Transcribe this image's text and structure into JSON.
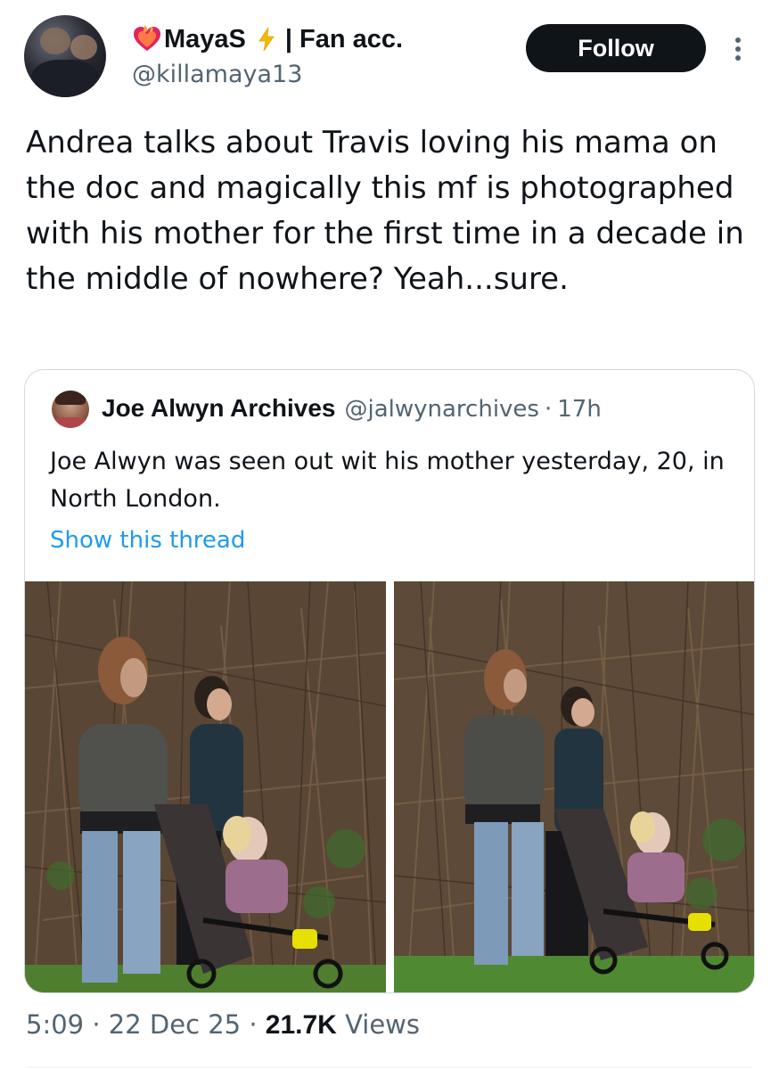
{
  "author": {
    "display_name": "MayaS",
    "name_suffix": "| Fan acc.",
    "handle": "@killamaya13",
    "heart_icon": "flaming-heart-icon",
    "bolt_icon": "lightning-icon"
  },
  "actions": {
    "follow_label": "Follow",
    "more_icon": "more-vertical-icon"
  },
  "tweet": {
    "text": "Andrea talks about Travis loving his mama on the doc and magically this mf is photographed with his mother for the first time in a decade in the middle of nowhere? Yeah...sure."
  },
  "quote": {
    "name": "Joe Alwyn Archives",
    "handle": "@jalwynarchives",
    "separator": "·",
    "time": "17h",
    "text": "Joe Alwyn was seen out wit his mother yesterday, 20, in North London.",
    "link": "Show this thread",
    "photo_count": 2
  },
  "meta": {
    "time": "5:09",
    "sep1": " · ",
    "date": "22 Dec 25",
    "sep2": " · ",
    "views_count": "21.7K",
    "views_label": " Views"
  },
  "colors": {
    "text": "#0f1419",
    "secondary": "#536471",
    "link": "#1d9bf0",
    "button_bg": "#0f1419",
    "border": "#cfd9de"
  }
}
